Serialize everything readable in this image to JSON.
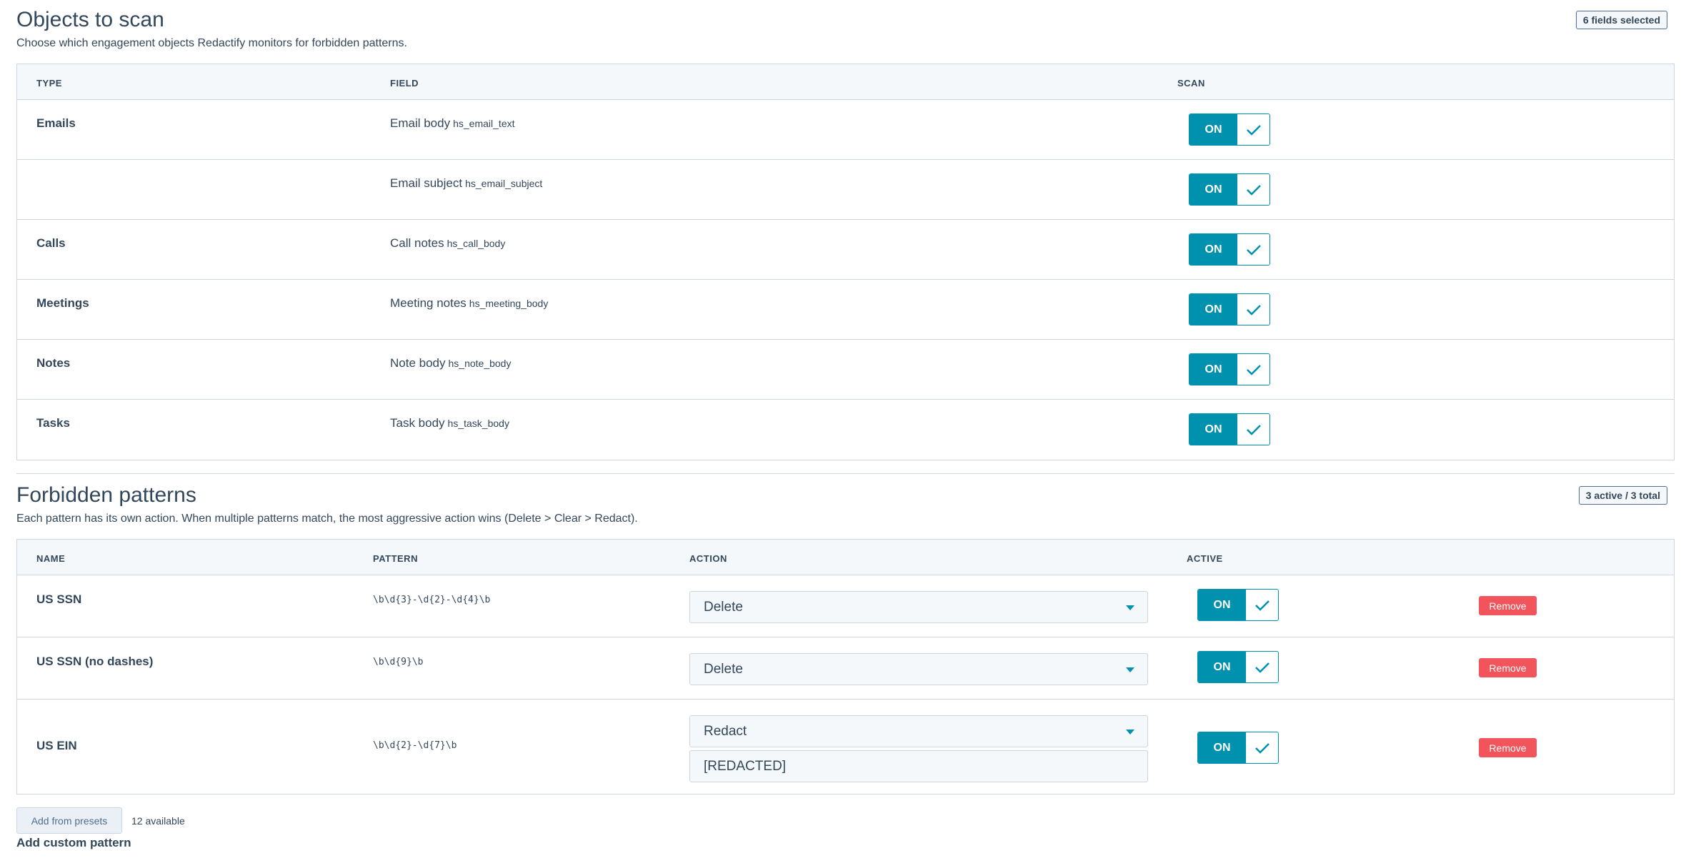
{
  "objects_section": {
    "title": "Objects to scan",
    "description": "Choose which engagement objects Redactify monitors for forbidden patterns.",
    "badge": "6 fields selected",
    "columns": {
      "type": "TYPE",
      "field": "FIELD",
      "scan": "SCAN"
    },
    "rows": [
      {
        "type": "Emails",
        "field": "Email body",
        "key": "hs_email_text",
        "toggle": "ON"
      },
      {
        "type": "",
        "field": "Email subject",
        "key": "hs_email_subject",
        "toggle": "ON"
      },
      {
        "type": "Calls",
        "field": "Call notes",
        "key": "hs_call_body",
        "toggle": "ON"
      },
      {
        "type": "Meetings",
        "field": "Meeting notes",
        "key": "hs_meeting_body",
        "toggle": "ON"
      },
      {
        "type": "Notes",
        "field": "Note body",
        "key": "hs_note_body",
        "toggle": "ON"
      },
      {
        "type": "Tasks",
        "field": "Task body",
        "key": "hs_task_body",
        "toggle": "ON"
      }
    ]
  },
  "patterns_section": {
    "title": "Forbidden patterns",
    "description": "Each pattern has its own action. When multiple patterns match, the most aggressive action wins (Delete > Clear > Redact).",
    "badge": "3 active / 3 total",
    "columns": {
      "name": "NAME",
      "pattern": "PATTERN",
      "action": "ACTION",
      "active": "ACTIVE"
    },
    "rows": [
      {
        "name": "US SSN",
        "pattern": "\\b\\d{3}-\\d{2}-\\d{4}\\b",
        "action": "Delete",
        "toggle": "ON",
        "remove": "Remove"
      },
      {
        "name": "US SSN (no dashes)",
        "pattern": "\\b\\d{9}\\b",
        "action": "Delete",
        "toggle": "ON",
        "remove": "Remove"
      },
      {
        "name": "US EIN",
        "pattern": "\\b\\d{2}-\\d{7}\\b",
        "action": "Redact",
        "replacement": "[REDACTED]",
        "toggle": "ON",
        "remove": "Remove"
      }
    ]
  },
  "footer": {
    "presets_button": "Add from presets",
    "available": "12 available",
    "custom_link": "Add custom pattern"
  },
  "colors": {
    "accent": "#0091ae",
    "danger": "#f2545b",
    "text": "#33475b",
    "border": "#cbd6e2",
    "header_bg": "#f5f8fa"
  }
}
